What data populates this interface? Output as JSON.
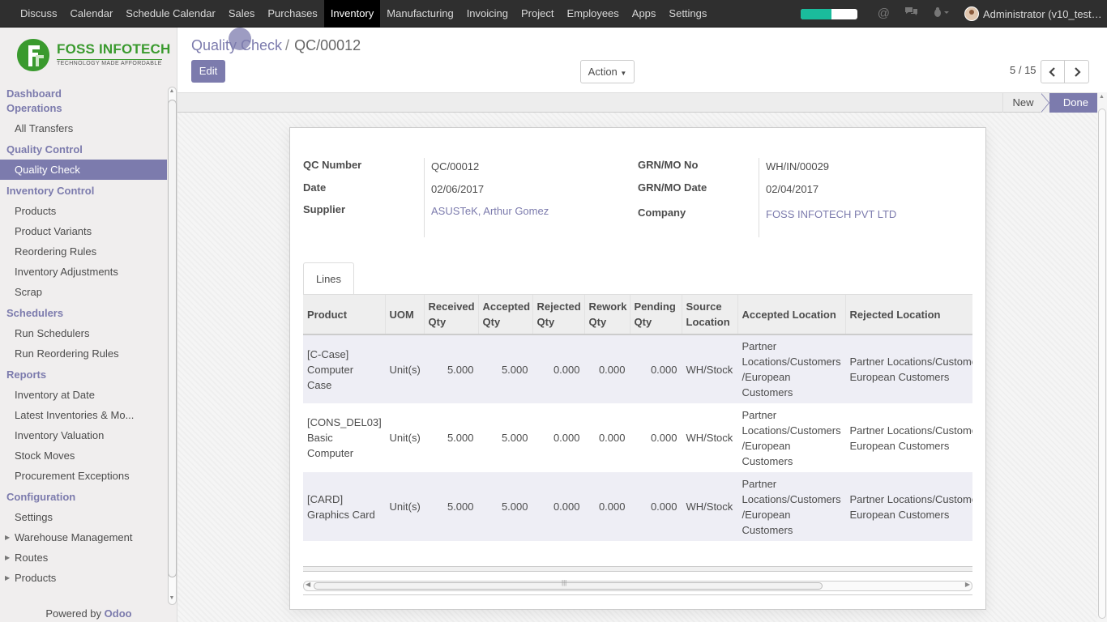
{
  "topbar": {
    "menu": [
      {
        "label": "Discuss"
      },
      {
        "label": "Calendar"
      },
      {
        "label": "Schedule Calendar"
      },
      {
        "label": "Sales"
      },
      {
        "label": "Purchases"
      },
      {
        "label": "Inventory",
        "active": true
      },
      {
        "label": "Manufacturing"
      },
      {
        "label": "Invoicing"
      },
      {
        "label": "Project"
      },
      {
        "label": "Employees"
      },
      {
        "label": "Apps"
      },
      {
        "label": "Settings"
      }
    ],
    "progress_fraction": 0.55,
    "progress_color": "#1abc9c",
    "user_label": "Administrator (v10_test…",
    "icons": [
      "at-icon",
      "chat-icon",
      "bug-icon"
    ]
  },
  "logo": {
    "brand": "FOSS INFOTECH",
    "tagline": "TECHNOLOGY MADE AFFORDABLE",
    "color": "#3a9a2e"
  },
  "sidebar": {
    "sections": [
      {
        "title": "Dashboard",
        "items": []
      },
      {
        "title": "Operations",
        "items": [
          {
            "label": "All Transfers"
          }
        ]
      },
      {
        "title": "Quality Control",
        "items": [
          {
            "label": "Quality Check",
            "active": true
          }
        ]
      },
      {
        "title": "Inventory Control",
        "items": [
          {
            "label": "Products"
          },
          {
            "label": "Product Variants"
          },
          {
            "label": "Reordering Rules"
          },
          {
            "label": "Inventory Adjustments"
          },
          {
            "label": "Scrap"
          }
        ]
      },
      {
        "title": "Schedulers",
        "items": [
          {
            "label": "Run Schedulers"
          },
          {
            "label": "Run Reordering Rules"
          }
        ]
      },
      {
        "title": "Reports",
        "items": [
          {
            "label": "Inventory at Date"
          },
          {
            "label": "Latest Inventories & Mo..."
          },
          {
            "label": "Inventory Valuation"
          },
          {
            "label": "Stock Moves"
          },
          {
            "label": "Procurement Exceptions"
          }
        ]
      },
      {
        "title": "Configuration",
        "items": [
          {
            "label": "Settings"
          },
          {
            "label": "Warehouse Management",
            "expandable": true
          },
          {
            "label": "Routes",
            "expandable": true
          },
          {
            "label": "Products",
            "expandable": true
          }
        ]
      }
    ],
    "powered_by": "Powered by",
    "powered_brand": "Odoo"
  },
  "control_panel": {
    "breadcrumb_parent": "Quality Check",
    "breadcrumb_sep": "/",
    "breadcrumb_current": "QC/00012",
    "edit_label": "Edit",
    "action_label": "Action",
    "pager": "5 / 15"
  },
  "statusbar": {
    "states": [
      "New",
      "Done"
    ],
    "current": "Done"
  },
  "form": {
    "qc_number_label": "QC Number",
    "qc_number": "QC/00012",
    "date_label": "Date",
    "date": "02/06/2017",
    "supplier_label": "Supplier",
    "supplier": "ASUSTeK, Arthur Gomez",
    "grn_no_label": "GRN/MO No",
    "grn_no": "WH/IN/00029",
    "grn_date_label": "GRN/MO Date",
    "grn_date": "02/04/2017",
    "company_label": "Company",
    "company": "FOSS INFOTECH PVT LTD"
  },
  "lines": {
    "tab_label": "Lines",
    "columns": [
      "Product",
      "UOM",
      "Received Qty",
      "Accepted Qty",
      "Rejected Qty",
      "Rework Qty",
      "Pending Qty",
      "Source Location",
      "Accepted Location",
      "Rejected Location"
    ],
    "rows": [
      {
        "product": "[C-Case] Computer Case",
        "uom": "Unit(s)",
        "received": "5.000",
        "accepted": "5.000",
        "rejected": "0.000",
        "rework": "0.000",
        "pending": "0.000",
        "source": "WH/Stock",
        "accepted_loc": "Partner Locations/Customers /European Customers",
        "rejected_loc": "Partner Locations/Customers/Non European Customers"
      },
      {
        "product": "[CONS_DEL03] Basic Computer",
        "uom": "Unit(s)",
        "received": "5.000",
        "accepted": "5.000",
        "rejected": "0.000",
        "rework": "0.000",
        "pending": "0.000",
        "source": "WH/Stock",
        "accepted_loc": "Partner Locations/Customers /European Customers",
        "rejected_loc": "Partner Locations/Customers/Non European Customers"
      },
      {
        "product": "[CARD] Graphics Card",
        "uom": "Unit(s)",
        "received": "5.000",
        "accepted": "5.000",
        "rejected": "0.000",
        "rework": "0.000",
        "pending": "0.000",
        "source": "WH/Stock",
        "accepted_loc": "Partner Locations/Customers /European Customers",
        "rejected_loc": "Partner Locations/Customers/Non European Customers"
      }
    ]
  },
  "colors": {
    "accent": "#7c7bad",
    "topbar": "#2f2f2f"
  }
}
